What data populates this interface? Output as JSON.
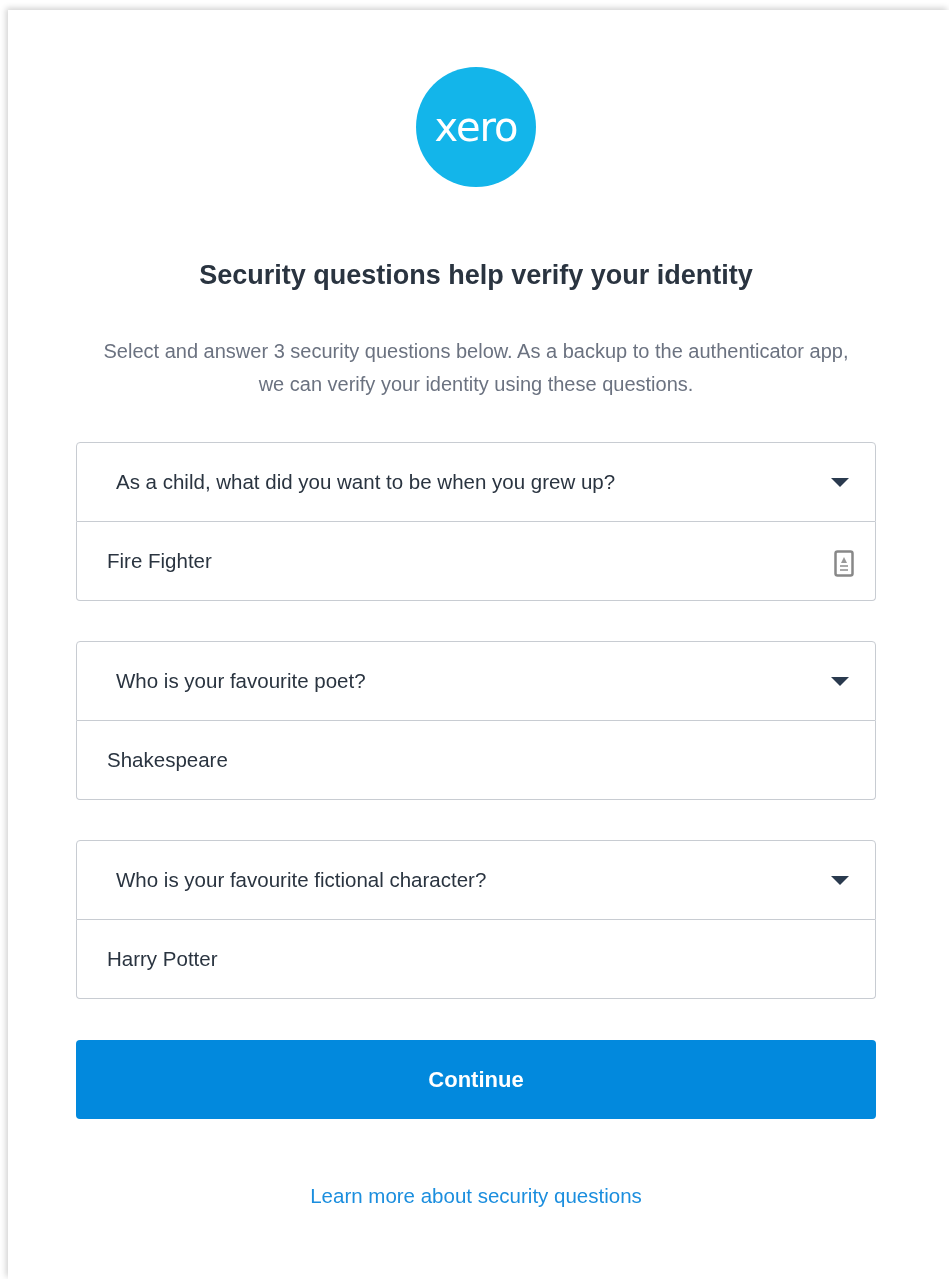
{
  "logo": {
    "text": "xero"
  },
  "title": "Security questions help verify your identity",
  "intro": "Select and answer 3 security questions below. As a backup to the authenticator app, we can verify your identity using these questions.",
  "questions": [
    {
      "question": "As a child, what did you want to be when you grew up?",
      "answer": "Fire Fighter",
      "autofill_icon": true
    },
    {
      "question": "Who is your favourite poet?",
      "answer": "Shakespeare",
      "autofill_icon": false
    },
    {
      "question": "Who is your favourite fictional character?",
      "answer": "Harry Potter",
      "autofill_icon": false
    }
  ],
  "continue_button": "Continue",
  "help_link": "Learn more about security questions"
}
